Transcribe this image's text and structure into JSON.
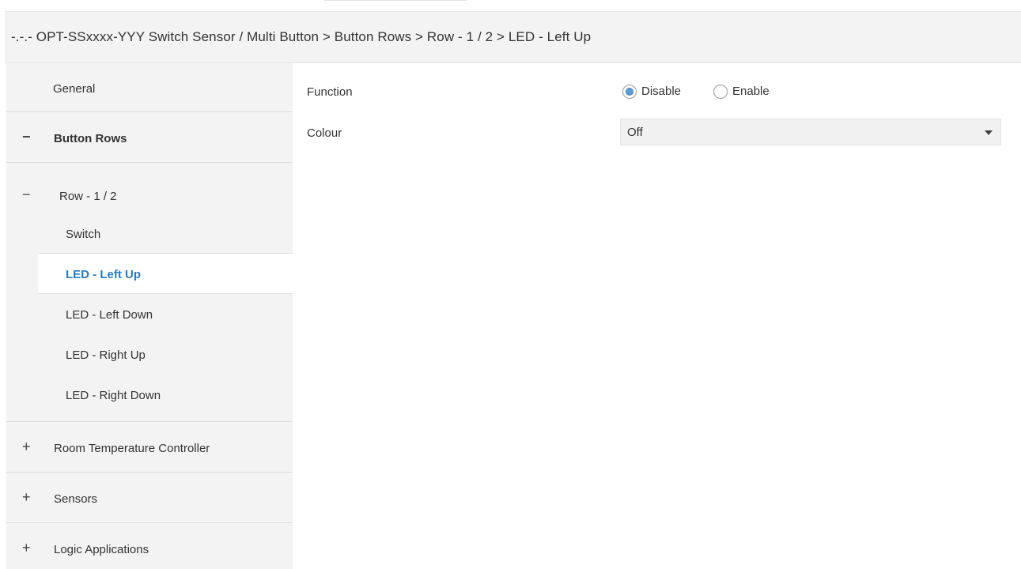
{
  "breadcrumb": "-.-.- OPT-SSxxxx-YYY Switch Sensor / Multi Button > Button Rows > Row - 1 / 2 > LED - Left Up",
  "sidebar": {
    "items": [
      {
        "label": "General",
        "sign": ""
      },
      {
        "label": "Button Rows",
        "sign": "−"
      },
      {
        "label": "Row - 1 / 2",
        "sign": "−"
      },
      {
        "label": "Switch",
        "sign": ""
      },
      {
        "label": "LED - Left Up",
        "sign": ""
      },
      {
        "label": "LED - Left Down",
        "sign": ""
      },
      {
        "label": "LED - Right Up",
        "sign": ""
      },
      {
        "label": "LED - Right Down",
        "sign": ""
      },
      {
        "label": "Room Temperature Controller",
        "sign": "+"
      },
      {
        "label": "Sensors",
        "sign": "+"
      },
      {
        "label": "Logic Applications",
        "sign": "+"
      }
    ],
    "active_index": 4
  },
  "form": {
    "function_label": "Function",
    "function_options": [
      "Disable",
      "Enable"
    ],
    "function_selected": "Disable",
    "colour_label": "Colour",
    "colour_value": "Off"
  },
  "colors": {
    "accent": "#2a7ab8",
    "sidebar_bg": "#f3f3f3",
    "header_bg": "#f3f3f3",
    "radio_checked": "#5a9bd3"
  },
  "icons": {
    "expanded": "minus-icon",
    "collapsed": "plus-icon",
    "dropdown": "chevron-down-icon"
  }
}
